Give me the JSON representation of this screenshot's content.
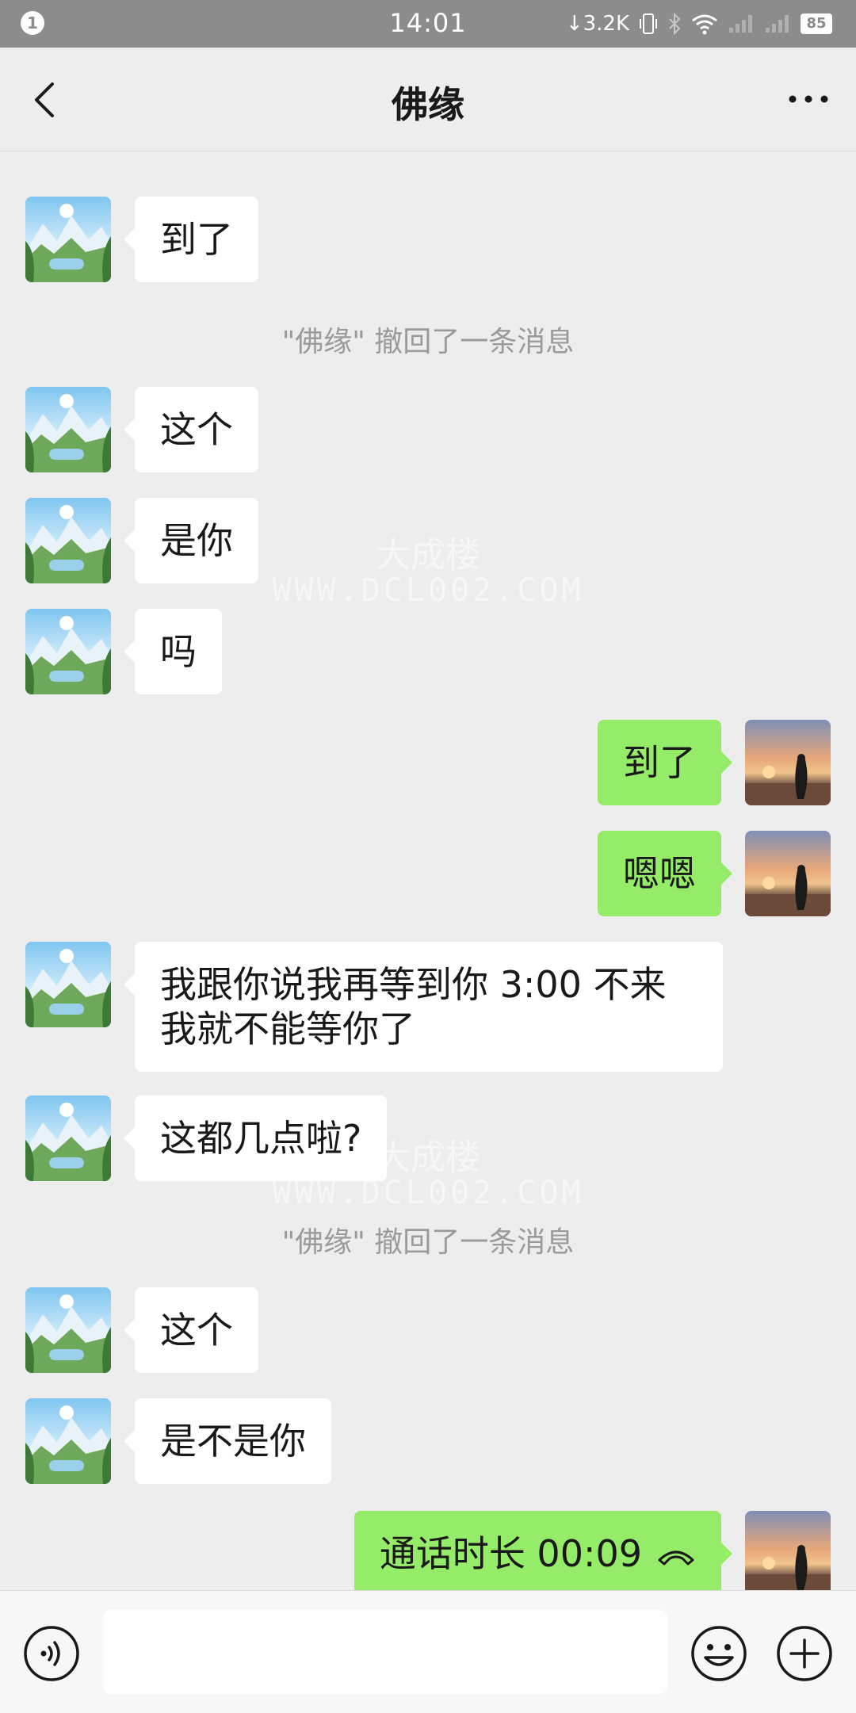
{
  "status_bar": {
    "notification_count": "1",
    "time": "14:01",
    "net_speed": "↓3.2K",
    "battery": "85"
  },
  "header": {
    "title": "佛缘"
  },
  "messages": [
    {
      "from": "contact",
      "text": "到了"
    },
    {
      "system": "\"佛缘\" 撤回了一条消息"
    },
    {
      "from": "contact",
      "text": "这个"
    },
    {
      "from": "contact",
      "text": "是你"
    },
    {
      "from": "contact",
      "text": "吗"
    },
    {
      "from": "me",
      "text": "到了"
    },
    {
      "from": "me",
      "text": "嗯嗯"
    },
    {
      "from": "contact",
      "text": "我跟你说我再等到你 3:00 不来我就不能等你了"
    },
    {
      "from": "contact",
      "text": "这都几点啦?"
    },
    {
      "system": "\"佛缘\" 撤回了一条消息"
    },
    {
      "from": "contact",
      "text": "这个"
    },
    {
      "from": "contact",
      "text": "是不是你"
    },
    {
      "from": "me",
      "text": "通话时长 00:09",
      "icon": "hangup-phone-icon"
    }
  ],
  "watermark": {
    "line1": "大成楼",
    "line2": "WWW.DCL002.COM"
  },
  "input_bar": {
    "value": "",
    "placeholder": ""
  },
  "colors": {
    "background": "#ededed",
    "outgoing_bubble": "#95ec69",
    "incoming_bubble": "#ffffff"
  }
}
